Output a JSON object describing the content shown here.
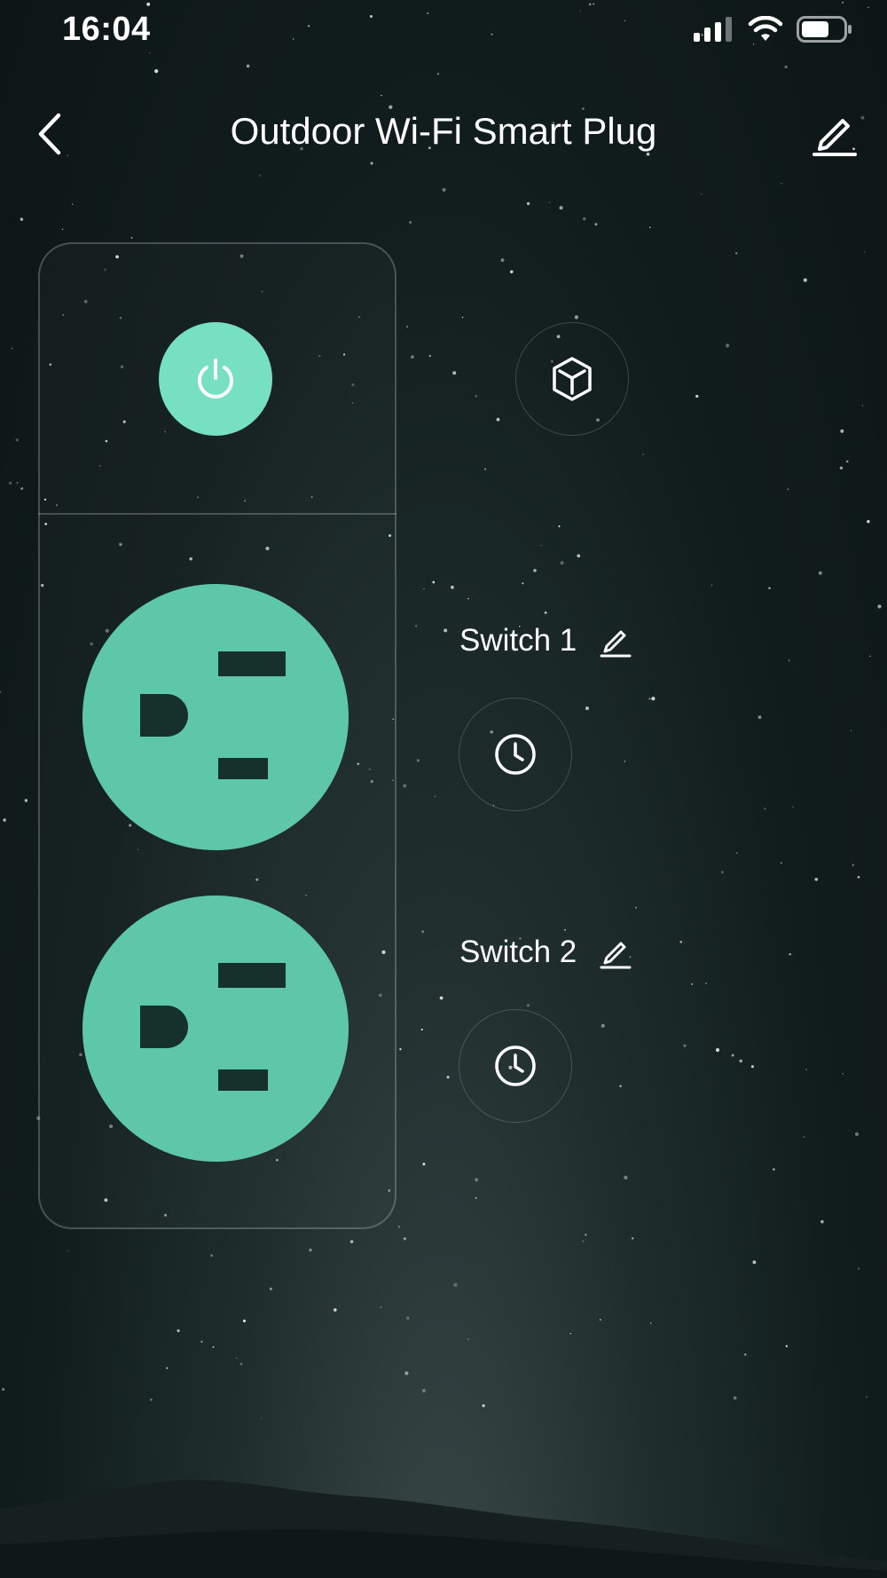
{
  "status_bar": {
    "time": "16:04"
  },
  "header": {
    "title": "Outdoor Wi-Fi Smart Plug",
    "back_icon": "chevron-left-icon",
    "edit_icon": "pencil-icon"
  },
  "controls": {
    "power_icon": "power-icon",
    "scene_icon": "cube-icon"
  },
  "switches": [
    {
      "label": "Switch 1",
      "edit_icon": "pencil-icon",
      "timer_icon": "clock-icon"
    },
    {
      "label": "Switch 2",
      "edit_icon": "pencil-icon",
      "timer_icon": "clock-icon"
    }
  ],
  "colors": {
    "accent": "#78e0c2",
    "outlet": "#5fc7a9",
    "outlet_slot": "#16302b",
    "background": "#0f1b1a"
  }
}
